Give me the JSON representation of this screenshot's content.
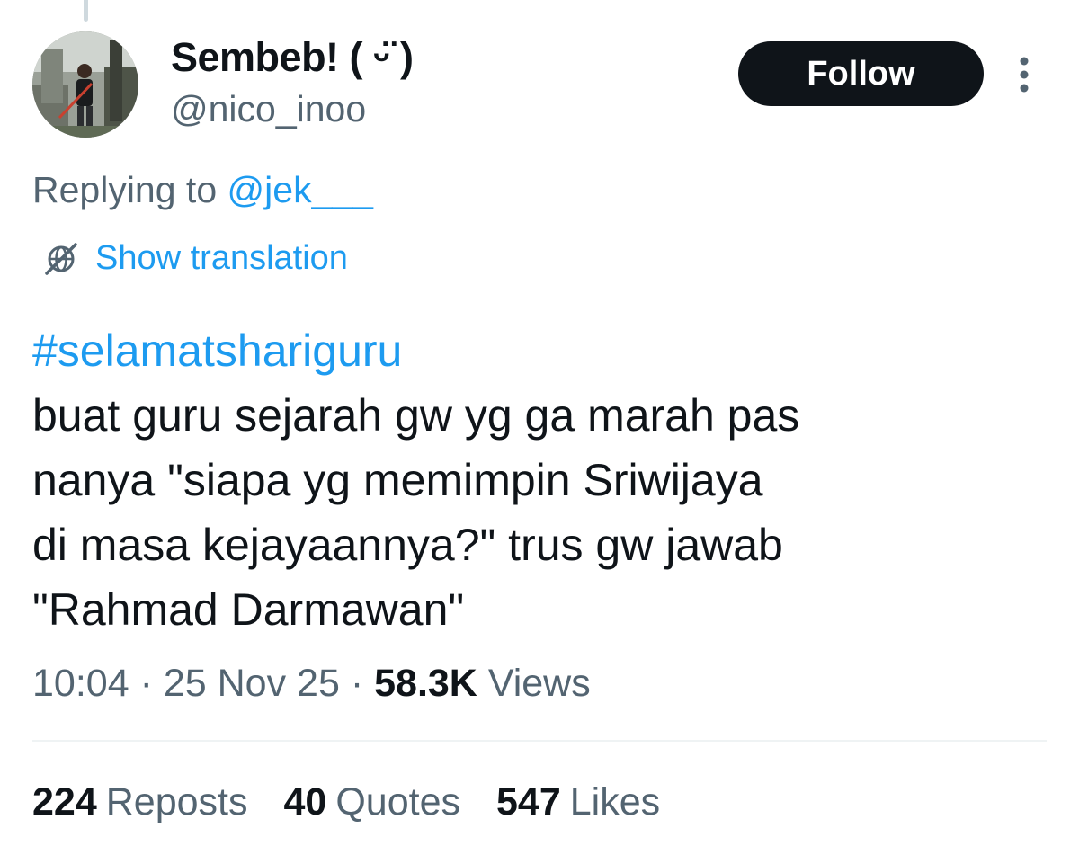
{
  "author": {
    "display_name": "Sembeb! ( ᵕ̈ )",
    "handle": "@nico_inoo"
  },
  "follow_label": "Follow",
  "reply": {
    "prefix": "Replying to",
    "mention": "@jek___"
  },
  "translation_label": "Show translation",
  "tweet": {
    "hashtag": "#selamatshariguru",
    "lines": [
      "buat guru sejarah gw yg ga marah pas",
      "nanya \"siapa yg memimpin Sriwijaya",
      "di masa kejayaannya?\" trus gw jawab",
      "\"Rahmad Darmawan\""
    ]
  },
  "meta": {
    "time": "10:04",
    "separator": "·",
    "date": "25 Nov 25",
    "views_count": "58.3K",
    "views_label": "Views"
  },
  "stats": {
    "reposts_count": "224",
    "reposts_label": "Reposts",
    "quotes_count": "40",
    "quotes_label": "Quotes",
    "likes_count": "547",
    "likes_label": "Likes"
  },
  "colors": {
    "accent": "#1d9bf0",
    "text": "#0f1419",
    "secondary": "#536471",
    "follow_bg": "#0f1419"
  },
  "icons": {
    "more": "more-vertical-icon",
    "translate": "globe-slash-icon"
  }
}
